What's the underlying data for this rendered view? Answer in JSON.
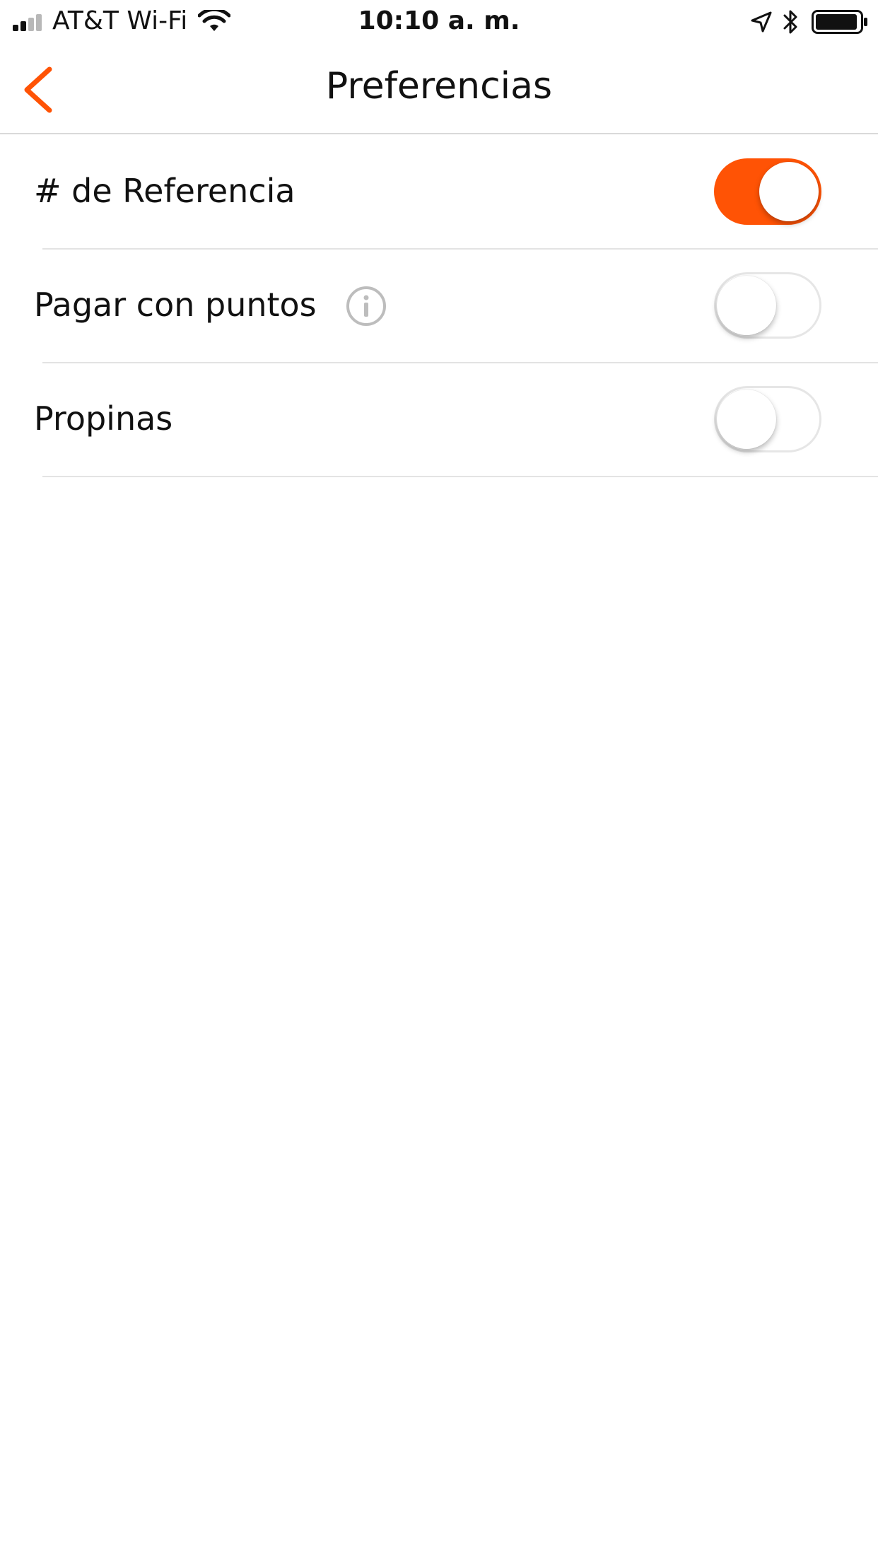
{
  "status_bar": {
    "carrier": "AT&T Wi-Fi",
    "time": "10:10 a. m.",
    "signal_icon": "cellular-signal-icon",
    "wifi_icon": "wifi-icon",
    "location_icon": "location-arrow-icon",
    "bluetooth_icon": "bluetooth-icon",
    "battery_icon": "battery-icon"
  },
  "nav": {
    "title": "Preferencias",
    "back_icon": "chevron-left-icon"
  },
  "settings": [
    {
      "label": "# de Referencia",
      "enabled": true,
      "has_info": false
    },
    {
      "label": "Pagar con puntos",
      "enabled": false,
      "has_info": true,
      "info_icon": "info-circle-icon"
    },
    {
      "label": "Propinas",
      "enabled": false,
      "has_info": false
    }
  ],
  "colors": {
    "accent": "#FF5305",
    "divider": "#E3E3E3",
    "toggle_off_border": "#E6E6E6",
    "info_icon": "#BDBDBD",
    "text": "#111111"
  }
}
